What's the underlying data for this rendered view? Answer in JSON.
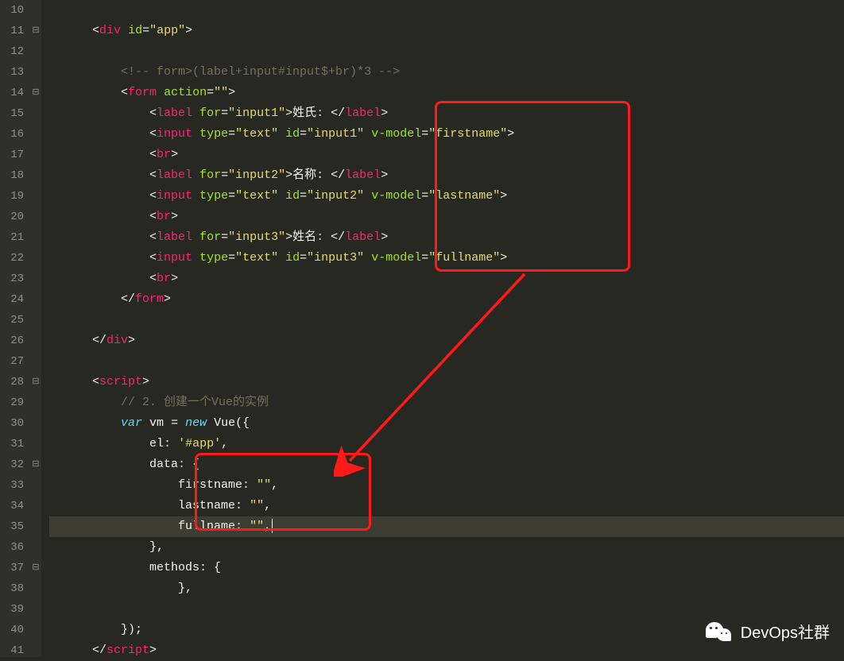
{
  "lineStart": 10,
  "foldMarks": {
    "11": "⊟",
    "14": "⊟",
    "28": "⊟",
    "32": "⊟",
    "37": "⊟"
  },
  "watermark": "DevOps社群",
  "code": {
    "l10": {
      "indent": ""
    },
    "l11": {
      "indent": "      ",
      "tag": "div",
      "attr_id": "id",
      "val_id": "\"app\""
    },
    "l12": {
      "indent": ""
    },
    "l13": {
      "indent": "          ",
      "comment": "<!-- form>(label+input#input$+br)*3 -->"
    },
    "l14": {
      "indent": "          ",
      "tag": "form",
      "attr": "action",
      "val": "\"\""
    },
    "l15": {
      "indent": "              ",
      "tag": "label",
      "attr": "for",
      "val": "\"input1\"",
      "text": "姓氏: ",
      "close": "label"
    },
    "l16": {
      "indent": "              ",
      "tag": "input",
      "a1": "type",
      "v1": "\"text\"",
      "a2": "id",
      "v2": "\"input1\"",
      "a3": "v-model",
      "v3": "\"firstname\""
    },
    "l17": {
      "indent": "              ",
      "tag": "br"
    },
    "l18": {
      "indent": "              ",
      "tag": "label",
      "attr": "for",
      "val": "\"input2\"",
      "text": "名称: ",
      "close": "label"
    },
    "l19": {
      "indent": "              ",
      "tag": "input",
      "a1": "type",
      "v1": "\"text\"",
      "a2": "id",
      "v2": "\"input2\"",
      "a3": "v-model",
      "v3": "\"lastname\""
    },
    "l20": {
      "indent": "              ",
      "tag": "br"
    },
    "l21": {
      "indent": "              ",
      "tag": "label",
      "attr": "for",
      "val": "\"input3\"",
      "text": "姓名: ",
      "close": "label"
    },
    "l22": {
      "indent": "              ",
      "tag": "input",
      "a1": "type",
      "v1": "\"text\"",
      "a2": "id",
      "v2": "\"input3\"",
      "a3": "v-model",
      "v3": "\"fullname\""
    },
    "l23": {
      "indent": "              ",
      "tag": "br"
    },
    "l24": {
      "indent": "          ",
      "closeTag": "form"
    },
    "l25": {
      "indent": ""
    },
    "l26": {
      "indent": "      ",
      "closeTag": "div"
    },
    "l27": {
      "indent": ""
    },
    "l28": {
      "indent": "      ",
      "tag": "script"
    },
    "l29": {
      "indent": "          ",
      "comment": "// 2. 创建一个Vue的实例"
    },
    "l30": {
      "indent": "          ",
      "kw": "var",
      "id": "vm",
      "eq": " = ",
      "kw2": "new",
      "fn": "Vue",
      "rest": "({"
    },
    "l31": {
      "indent": "              ",
      "key": "el:",
      "val": "'#app'",
      "tail": ","
    },
    "l32": {
      "indent": "              ",
      "key": "data:",
      "rest": " {"
    },
    "l33": {
      "indent": "                  ",
      "key": "firstname:",
      "val": "\"\"",
      "tail": ","
    },
    "l34": {
      "indent": "                  ",
      "key": "lastname:",
      "val": "\"\"",
      "tail": ","
    },
    "l35": {
      "indent": "                  ",
      "key": "fullname:",
      "val": "\"\"",
      "tail": ","
    },
    "l36": {
      "indent": "              ",
      "rest": "},"
    },
    "l37": {
      "indent": "              ",
      "key": "methods:",
      "rest": " {"
    },
    "l38": {
      "indent": "                  ",
      "rest": "},"
    },
    "l39": {
      "indent": ""
    },
    "l40": {
      "indent": "          ",
      "rest": "});"
    },
    "l41": {
      "indent": "      ",
      "closeTag": "script"
    }
  }
}
